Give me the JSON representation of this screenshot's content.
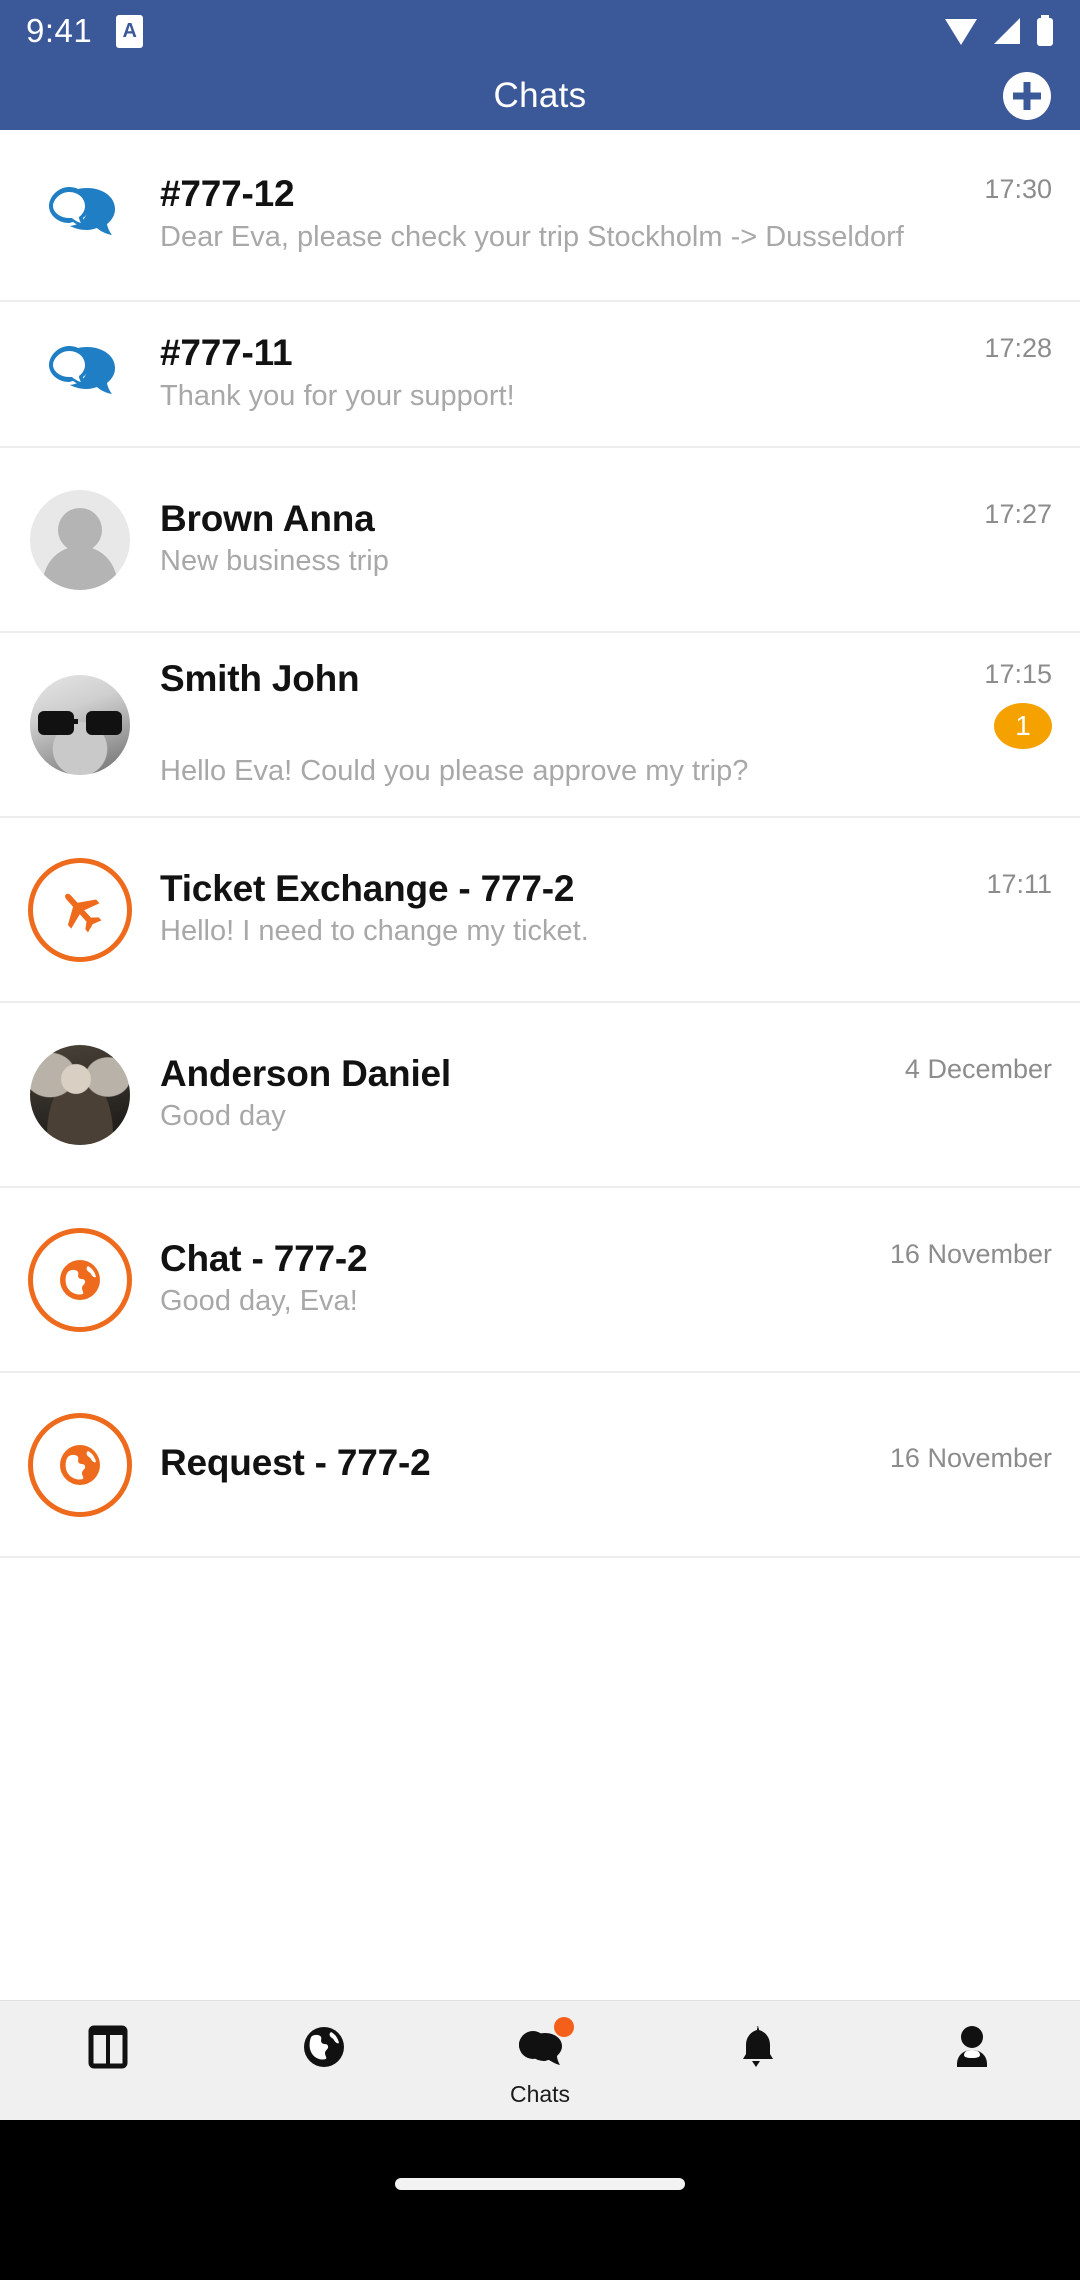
{
  "status_bar": {
    "time": "9:41",
    "app_icon_letter": "A",
    "icons": [
      "wifi-icon",
      "signal-icon",
      "battery-icon"
    ]
  },
  "header": {
    "title": "Chats",
    "add_icon": "plus-circle-icon",
    "background_color": "#3b5899"
  },
  "colors": {
    "accent_orange": "#ee6a1c",
    "badge_orange": "#f5a100",
    "chat_blue": "#1a73b8",
    "header_blue": "#3b5899"
  },
  "chats": [
    {
      "icon": "chat-bubbles-icon",
      "icon_type": "bubbles",
      "title": "#777-12",
      "subtitle": "Dear Eva, please check your trip Stockholm -> Dusseldorf",
      "time": "17:30",
      "badge": ""
    },
    {
      "icon": "chat-bubbles-icon",
      "icon_type": "bubbles",
      "title": "#777-11",
      "subtitle": "Thank you for your support!",
      "time": "17:28",
      "badge": ""
    },
    {
      "icon": "avatar-placeholder",
      "icon_type": "avatar-placeholder",
      "title": "Brown Anna",
      "subtitle": "New business trip",
      "time": "17:27",
      "badge": ""
    },
    {
      "icon": "avatar-photo-smith-john",
      "icon_type": "avatar-john",
      "title": "Smith John",
      "subtitle": "Hello Eva! Could you please approve my trip?",
      "time": "17:15",
      "badge": "1"
    },
    {
      "icon": "airplane-circle-icon",
      "icon_type": "airplane",
      "title": "Ticket Exchange - 777-2",
      "subtitle": "Hello! I need to change my ticket.",
      "time": "17:11",
      "badge": ""
    },
    {
      "icon": "avatar-photo-anderson-daniel",
      "icon_type": "avatar-daniel",
      "title": "Anderson Daniel",
      "subtitle": "Good day",
      "time": "4 December",
      "badge": ""
    },
    {
      "icon": "globe-circle-icon",
      "icon_type": "globe",
      "title": "Chat - 777-2",
      "subtitle": "Good day, Eva!",
      "time": "16 November",
      "badge": ""
    },
    {
      "icon": "globe-circle-icon",
      "icon_type": "globe",
      "title": "Request - 777-2",
      "subtitle": "",
      "time": "16 November",
      "badge": ""
    }
  ],
  "bottom_nav": {
    "items": [
      {
        "icon": "dashboard-icon",
        "label": "",
        "active": false,
        "dot": false
      },
      {
        "icon": "globe-icon",
        "label": "",
        "active": false,
        "dot": false
      },
      {
        "icon": "chats-icon",
        "label": "Chats",
        "active": true,
        "dot": true
      },
      {
        "icon": "bell-icon",
        "label": "",
        "active": false,
        "dot": false
      },
      {
        "icon": "person-icon",
        "label": "",
        "active": false,
        "dot": false
      }
    ]
  }
}
